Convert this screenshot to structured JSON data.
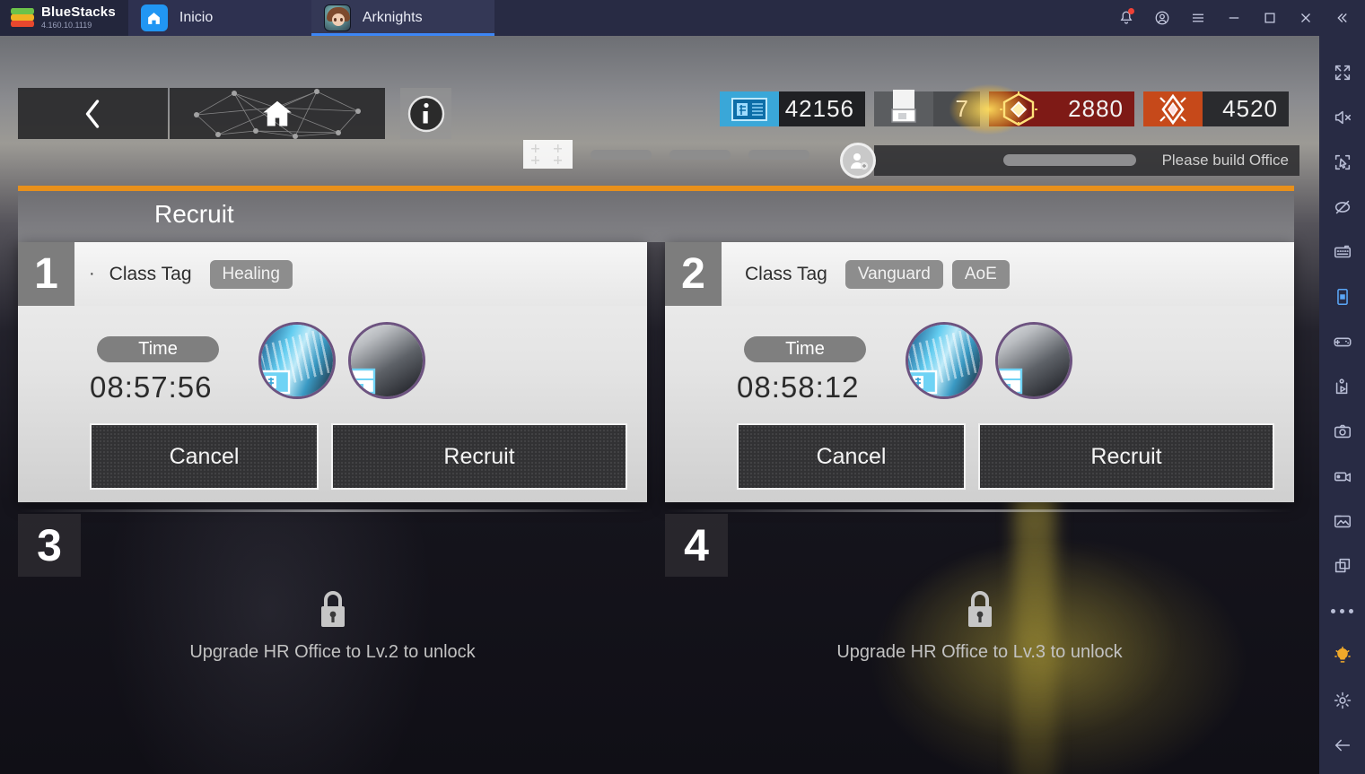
{
  "titlebar": {
    "brand": "BlueStacks",
    "version": "4.160.10.1119",
    "tabs": [
      {
        "label": "Inicio",
        "icon": "home-icon"
      },
      {
        "label": "Arknights",
        "icon": "arknights-app-icon"
      }
    ],
    "buttons": [
      {
        "name": "notifications-button",
        "icon": "bell-icon",
        "badge": true
      },
      {
        "name": "account-button",
        "icon": "account-circle-icon"
      },
      {
        "name": "menu-button",
        "icon": "hamburger-menu-icon"
      },
      {
        "name": "minimize-button",
        "icon": "minimize-icon"
      },
      {
        "name": "maximize-button",
        "icon": "maximize-icon"
      },
      {
        "name": "close-button",
        "icon": "close-icon"
      },
      {
        "name": "collapse-sidebar-button",
        "icon": "double-chevron-left-icon"
      }
    ]
  },
  "sidebar": {
    "items": [
      {
        "name": "fullscreen-button",
        "icon": "fullscreen-icon"
      },
      {
        "name": "mute-button",
        "icon": "volume-mute-icon"
      },
      {
        "name": "click-target-button",
        "icon": "cursor-target-icon"
      },
      {
        "name": "eye-off-button",
        "icon": "eye-off-icon"
      },
      {
        "name": "keyboard-controls-button",
        "icon": "keyboard-icon"
      },
      {
        "name": "portrait-mode-button",
        "icon": "phone-portrait-icon",
        "accent": "#5aa6f7"
      },
      {
        "name": "gamepad-button",
        "icon": "gamepad-icon"
      },
      {
        "name": "script-play-button",
        "icon": "script-play-icon"
      },
      {
        "name": "screenshot-button",
        "icon": "camera-icon"
      },
      {
        "name": "record-button",
        "icon": "video-camera-icon"
      },
      {
        "name": "media-manager-button",
        "icon": "gallery-icon"
      },
      {
        "name": "multi-instance-button",
        "icon": "copy-windows-icon"
      },
      {
        "name": "more-options-button",
        "icon": "ellipsis-icon"
      },
      {
        "name": "tips-button",
        "icon": "lightbulb-icon",
        "accent": "#f0a92a"
      },
      {
        "name": "settings-button",
        "icon": "gear-icon"
      },
      {
        "name": "back-button",
        "icon": "arrow-left-icon"
      }
    ]
  },
  "game": {
    "nav": {
      "back_icon": "chevron-left-icon",
      "home_icon": "home-network-icon",
      "info_icon": "info-circle-icon"
    },
    "currencies": [
      {
        "name": "lmd",
        "icon": "lmd-banknote-icon",
        "value": "42156",
        "icon_color": "#3aa7d8",
        "value_bg": "#1f2023"
      },
      {
        "name": "recruit-permit",
        "icon": "recruit-permit-icon",
        "value": "7",
        "icon_color": "#5b5d60",
        "value_bg": "#4a4c4f"
      },
      {
        "name": "orundum",
        "icon": "orundum-icon",
        "value": "2880",
        "icon_color": "#7e1a16",
        "value_bg": "#7e1a16"
      },
      {
        "name": "originite-prime",
        "icon": "originite-prime-icon",
        "value": "4520",
        "icon_color": "#c6491a",
        "value_bg": "#2a2b2e"
      }
    ],
    "notice": {
      "text": "Please build Office",
      "icon": "person-add-icon"
    },
    "panel": {
      "title": "Recruit",
      "accent_color": "#e8901b",
      "slots": [
        {
          "number": "1",
          "state": "active",
          "bullet": "·",
          "tag_label": "Class Tag",
          "tags": [
            "Healing"
          ],
          "time_label": "Time",
          "time_value": "08:57:56",
          "rewards": [
            "lmd-banknote-reward",
            "material-pouch-reward"
          ],
          "cancel_label": "Cancel",
          "recruit_label": "Recruit",
          "has_chevrons": false
        },
        {
          "number": "2",
          "state": "active",
          "bullet": "",
          "tag_label": "Class Tag",
          "tags": [
            "Vanguard",
            "AoE"
          ],
          "time_label": "Time",
          "time_value": "08:58:12",
          "rewards": [
            "lmd-banknote-reward",
            "material-pouch-reward"
          ],
          "cancel_label": "Cancel",
          "recruit_label": "Recruit",
          "has_chevrons": true
        },
        {
          "number": "3",
          "state": "locked",
          "lock_icon": "padlock-icon",
          "lock_text": "Upgrade HR Office to Lv.2 to unlock"
        },
        {
          "number": "4",
          "state": "locked",
          "lock_icon": "padlock-icon",
          "lock_text": "Upgrade HR Office to Lv.3 to unlock"
        }
      ]
    }
  }
}
